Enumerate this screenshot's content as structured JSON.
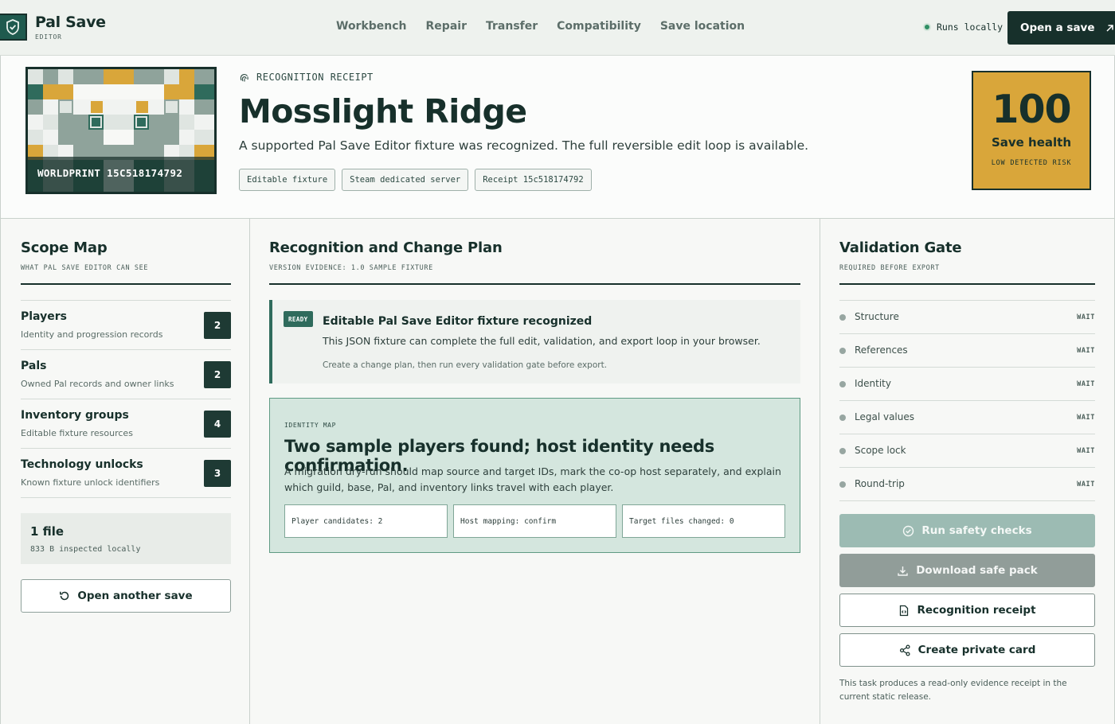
{
  "app": {
    "brand_title": "Pal Save",
    "brand_sub": "EDITOR"
  },
  "nav": {
    "items": [
      "Workbench",
      "Repair",
      "Transfer",
      "Compatibility",
      "Save location"
    ]
  },
  "header": {
    "local_status": "Runs locally",
    "open_button": "Open a save"
  },
  "hero": {
    "worldprint_caption": "WORLDPRINT 15C518174792",
    "kicker": "RECOGNITION RECEIPT",
    "title": "Mosslight Ridge",
    "description": "A supported Pal Save Editor fixture was recognized. The full reversible edit loop is available.",
    "chips": [
      "Editable fixture",
      "Steam dedicated server",
      "Receipt 15c518174792"
    ],
    "health": {
      "score": "100",
      "label": "Save health",
      "risk": "LOW DETECTED RISK"
    }
  },
  "scope": {
    "title": "Scope Map",
    "subtitle": "WHAT PAL SAVE EDITOR CAN SEE",
    "items": [
      {
        "name": "Players",
        "desc": "Identity and progression records",
        "count": "2"
      },
      {
        "name": "Pals",
        "desc": "Owned Pal records and owner links",
        "count": "2"
      },
      {
        "name": "Inventory groups",
        "desc": "Editable fixture resources",
        "count": "4"
      },
      {
        "name": "Technology unlocks",
        "desc": "Known fixture unlock identifiers",
        "count": "3"
      }
    ],
    "file_count": "1 file",
    "file_size": "833 B inspected locally",
    "open_another": "Open another save"
  },
  "plan": {
    "title": "Recognition and Change Plan",
    "subtitle": "VERSION EVIDENCE: 1.0 SAMPLE FIXTURE",
    "ready": {
      "badge": "READY",
      "title": "Editable Pal Save Editor fixture recognized",
      "desc": "This JSON fixture can complete the full edit, validation, and export loop in your browser.",
      "note": "Create a change plan, then run every validation gate before export."
    },
    "identity": {
      "kicker": "IDENTITY MAP",
      "title": "Two sample players found; host identity needs confirmation.",
      "desc": "A migration dry-run should map source and target IDs, mark the co-op host separately, and explain which guild, base, Pal, and inventory links travel with each player.",
      "stats": [
        "Player candidates: 2",
        "Host mapping: confirm",
        "Target files changed: 0"
      ]
    }
  },
  "validation": {
    "title": "Validation Gate",
    "subtitle": "REQUIRED BEFORE EXPORT",
    "gates": [
      {
        "label": "Structure",
        "status": "WAIT"
      },
      {
        "label": "References",
        "status": "WAIT"
      },
      {
        "label": "Identity",
        "status": "WAIT"
      },
      {
        "label": "Legal values",
        "status": "WAIT"
      },
      {
        "label": "Scope lock",
        "status": "WAIT"
      },
      {
        "label": "Round-trip",
        "status": "WAIT"
      }
    ],
    "buttons": {
      "run": "Run safety checks",
      "download": "Download safe pack",
      "receipt": "Recognition receipt",
      "card": "Create private card"
    },
    "note": "This task produces a read-only evidence receipt in the current static release."
  },
  "colors": {
    "ink": "#17302b",
    "accent_green": "#1f5a4e",
    "health_gold": "#d9a63a",
    "status_green": "#2f8f64"
  },
  "icons": [
    "shield-check-icon",
    "external-arrow-icon",
    "fingerprint-icon",
    "refresh-icon",
    "check-circle-icon",
    "download-icon",
    "file-code-icon",
    "share-icon"
  ]
}
